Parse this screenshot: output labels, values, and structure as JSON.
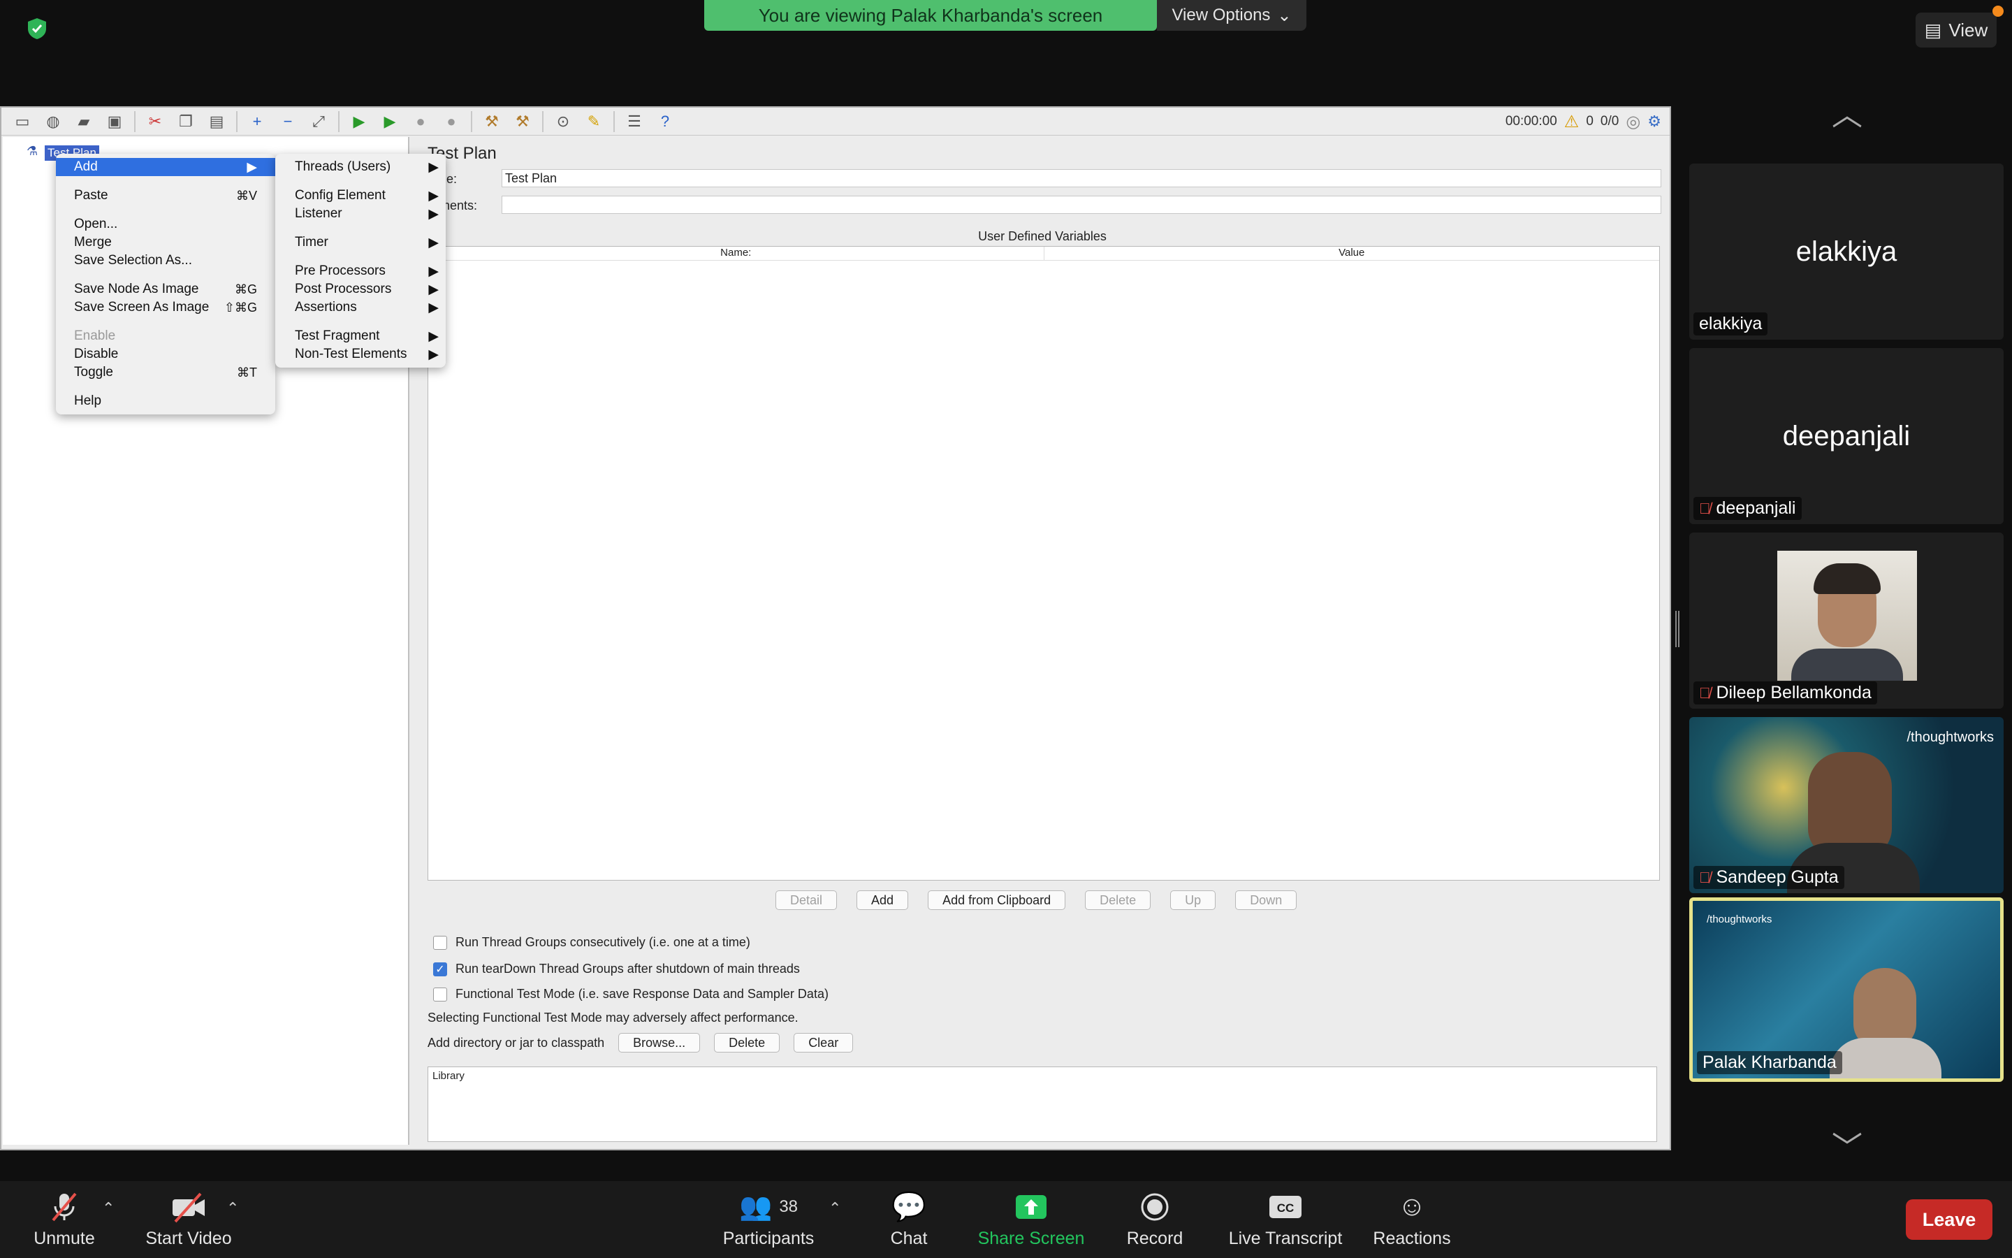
{
  "meeting": {
    "banner_text": "You are viewing Palak Kharbanda's screen",
    "view_options_label": "View Options",
    "view_label": "View"
  },
  "jmeter": {
    "toolbar": {
      "timer": "00:00:00",
      "warn_count": "0",
      "threads": "0/0"
    },
    "tree": {
      "selected_item": "Test Plan"
    },
    "plan": {
      "title": "Test Plan",
      "name_label": "ame:",
      "name_value": "Test Plan",
      "comments_label": "mments:",
      "comments_value": ""
    },
    "udv": {
      "title": "User Defined Variables",
      "col_name": "Name:",
      "col_value": "Value",
      "buttons": {
        "detail": "Detail",
        "add": "Add",
        "add_clipboard": "Add from Clipboard",
        "delete": "Delete",
        "up": "Up",
        "down": "Down"
      }
    },
    "options": {
      "run_consecutive": "Run Thread Groups consecutively (i.e. one at a time)",
      "run_teardown": "Run tearDown Thread Groups after shutdown of main threads",
      "functional_mode": "Functional Test Mode (i.e. save Response Data and Sampler Data)",
      "warning": "Selecting Functional Test Mode may adversely affect performance.",
      "run_consecutive_checked": false,
      "run_teardown_checked": true,
      "functional_mode_checked": false
    },
    "classpath": {
      "label": "Add directory or jar to classpath",
      "browse": "Browse...",
      "delete": "Delete",
      "clear": "Clear",
      "library_header": "Library"
    },
    "context_menu": {
      "add": "Add",
      "paste": "Paste",
      "paste_sc": "⌘V",
      "open": "Open...",
      "merge": "Merge",
      "save_selection": "Save Selection As...",
      "save_node_image": "Save Node As Image",
      "save_node_image_sc": "⌘G",
      "save_screen_image": "Save Screen As Image",
      "save_screen_image_sc": "⇧⌘G",
      "enable": "Enable",
      "disable": "Disable",
      "toggle": "Toggle",
      "toggle_sc": "⌘T",
      "help": "Help"
    },
    "submenu": {
      "threads": "Threads (Users)",
      "config": "Config Element",
      "listener": "Listener",
      "timer": "Timer",
      "pre": "Pre Processors",
      "post": "Post Processors",
      "assertions": "Assertions",
      "fragment": "Test Fragment",
      "non_test": "Non-Test Elements"
    }
  },
  "participants": [
    {
      "name": "elakkiya",
      "muted": false,
      "video": false
    },
    {
      "name": "deepanjali",
      "muted": true,
      "video": false
    },
    {
      "name": "Dileep Bellamkonda",
      "muted": true,
      "video": true
    },
    {
      "name": "Sandeep Gupta",
      "muted": true,
      "video": true,
      "brand": "/thoughtworks"
    },
    {
      "name": "Palak Kharbanda",
      "muted": false,
      "video": true,
      "brand": "/thoughtworks",
      "active_speaker": true
    }
  ],
  "controls": {
    "unmute": "Unmute",
    "start_video": "Start Video",
    "participants": "Participants",
    "participant_count": "38",
    "chat": "Chat",
    "share_screen": "Share Screen",
    "record": "Record",
    "live_transcript": "Live Transcript",
    "reactions": "Reactions",
    "leave": "Leave"
  },
  "colors": {
    "banner": "#4fbf6e",
    "share_green": "#23c55e",
    "leave_red": "#c62a26",
    "menu_highlight": "#2f6fe0",
    "active_speaker_border": "#e6e28a"
  },
  "icons": [
    "shield-icon",
    "chevron-down-icon",
    "view-grid-icon",
    "mic-off-icon",
    "video-off-icon",
    "participants-icon",
    "chat-icon",
    "share-icon",
    "record-icon",
    "cc-icon",
    "reactions-icon",
    "up-arrow-icon",
    "down-arrow-icon"
  ]
}
